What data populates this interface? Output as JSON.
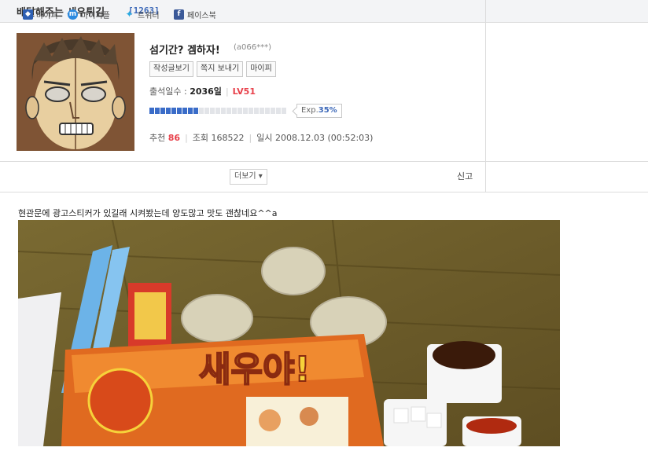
{
  "board": {
    "title": "배달해주는 새우튀김",
    "count": "[1263]"
  },
  "profile": {
    "nickname": "섬기간? 겜하자!",
    "user_id": "(a066***)",
    "buttons": [
      "작성글보기",
      "쪽지 보내기",
      "마이피"
    ],
    "attend_label": "출석일수 : ",
    "attend_days": "2036일",
    "level": "LV51",
    "exp_label": "Exp.",
    "exp_value": "35%",
    "exp_fraction": 0.35,
    "recommend_label": "추천",
    "recommend_value": "86",
    "views_label": "조회",
    "views_value": "168522",
    "date_label": "일시",
    "date_value": "2008.12.03 (00:52:03)"
  },
  "share": {
    "items": [
      {
        "label": "마이피",
        "icon": "cube-icon",
        "color": "#2d5fb3"
      },
      {
        "label": "마이피플",
        "icon": "mypeople-icon",
        "color": "#2b8ae0"
      },
      {
        "label": "트위터",
        "icon": "twitter-bird-icon",
        "color": "#2aa9e0"
      },
      {
        "label": "페이스북",
        "icon": "facebook-icon",
        "color": "#3b5998"
      }
    ],
    "more": "더보기",
    "report": "신고"
  },
  "post": {
    "text": "현관문에 광고스티커가 있길래 시켜봤는데 양도많고 맛도 괜찮네요^^a",
    "photo_box_text": "새우야!"
  }
}
